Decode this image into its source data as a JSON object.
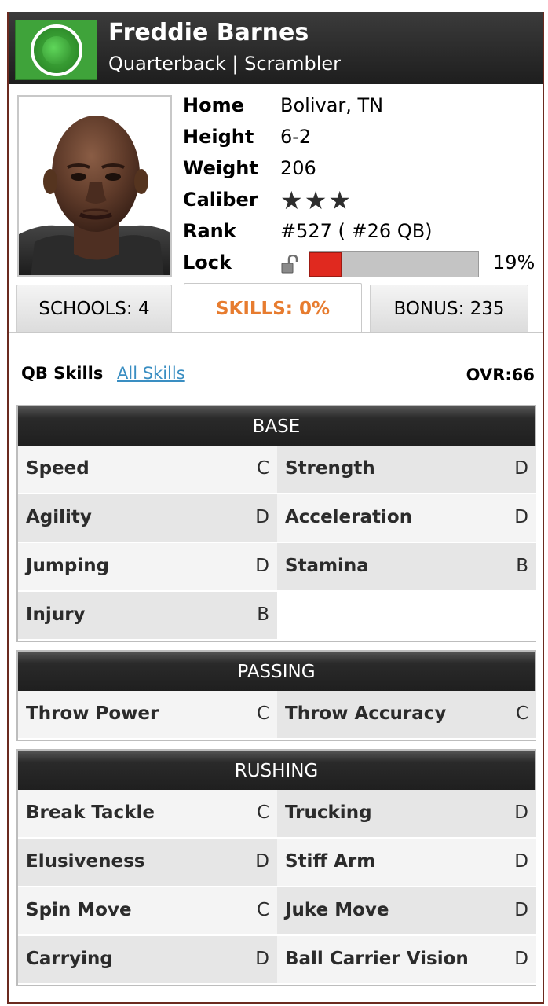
{
  "player": {
    "name": "Freddie Barnes",
    "subtitle": "Quarterback | Scrambler"
  },
  "info": {
    "home_label": "Home",
    "home_value": "Bolivar, TN",
    "height_label": "Height",
    "height_value": "6-2",
    "weight_label": "Weight",
    "weight_value": "206",
    "caliber_label": "Caliber",
    "caliber_stars": "★★★",
    "caliber_value": 3,
    "rank_label": "Rank",
    "rank_value": "#527 ( #26 QB)",
    "lock_label": "Lock",
    "lock_percent_text": "19%",
    "lock_percent": 19
  },
  "tabs": {
    "schools": "SCHOOLS: 4",
    "skills": "SKILLS: 0%",
    "bonus": "BONUS: 235"
  },
  "skills_header": {
    "title": "QB Skills",
    "link": "All Skills",
    "ovr": "OVR:66"
  },
  "groups": {
    "base": {
      "title": "BASE",
      "items": [
        {
          "name": "Speed",
          "grade": "C"
        },
        {
          "name": "Strength",
          "grade": "D"
        },
        {
          "name": "Agility",
          "grade": "D"
        },
        {
          "name": "Acceleration",
          "grade": "D"
        },
        {
          "name": "Jumping",
          "grade": "D"
        },
        {
          "name": "Stamina",
          "grade": "B"
        },
        {
          "name": "Injury",
          "grade": "B"
        }
      ]
    },
    "passing": {
      "title": "PASSING",
      "items": [
        {
          "name": "Throw Power",
          "grade": "C"
        },
        {
          "name": "Throw Accuracy",
          "grade": "C"
        }
      ]
    },
    "rushing": {
      "title": "RUSHING",
      "items": [
        {
          "name": "Break Tackle",
          "grade": "C"
        },
        {
          "name": "Trucking",
          "grade": "D"
        },
        {
          "name": "Elusiveness",
          "grade": "D"
        },
        {
          "name": "Stiff Arm",
          "grade": "D"
        },
        {
          "name": "Spin Move",
          "grade": "C"
        },
        {
          "name": "Juke Move",
          "grade": "D"
        },
        {
          "name": "Carrying",
          "grade": "D"
        },
        {
          "name": "Ball Carrier Vision",
          "grade": "D"
        }
      ]
    }
  },
  "colors": {
    "header_bg": "#1e1e1e",
    "badge_green": "#3fa33a",
    "lock_fill": "#e0291f",
    "active_tab_text": "#e77c2f",
    "link": "#3a8ec2",
    "card_border": "#6b2a1f"
  },
  "icons": {
    "badge": "green-target-badge-icon",
    "lock": "unlocked-padlock-icon",
    "stars": "star-icon"
  }
}
